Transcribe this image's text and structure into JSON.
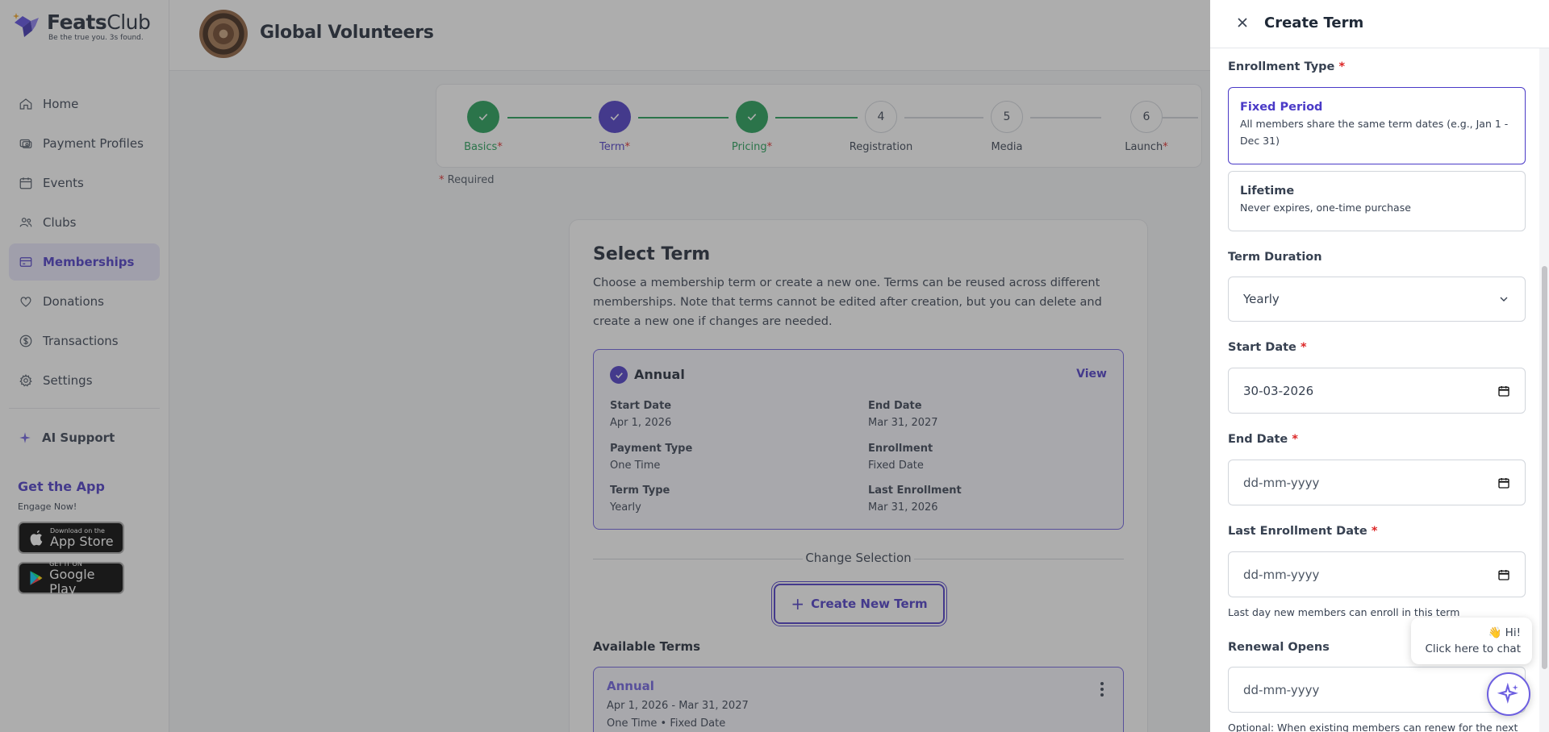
{
  "brand": {
    "name_bold": "Feats",
    "name_light": "Club",
    "tagline": "Be the true you. 3s found."
  },
  "sidebar": {
    "items": [
      {
        "label": "Home",
        "icon": "home-icon"
      },
      {
        "label": "Payment Profiles",
        "icon": "payment-icon"
      },
      {
        "label": "Events",
        "icon": "calendar-icon"
      },
      {
        "label": "Clubs",
        "icon": "users-icon"
      },
      {
        "label": "Memberships",
        "icon": "card-icon",
        "active": true
      },
      {
        "label": "Donations",
        "icon": "heart-icon"
      },
      {
        "label": "Transactions",
        "icon": "dollar-icon"
      },
      {
        "label": "Settings",
        "icon": "gear-icon"
      }
    ],
    "ai_support": "AI Support",
    "get_app": "Get the App",
    "engage": "Engage Now!",
    "app_store": {
      "small": "Download on the",
      "big": "App Store"
    },
    "google_play": {
      "small": "GET IT ON",
      "big": "Google Play"
    }
  },
  "org": {
    "name": "Global Volunteers"
  },
  "stepper": {
    "steps": [
      {
        "num": "",
        "label": "Basics",
        "required": "*",
        "state": "done"
      },
      {
        "num": "",
        "label": "Term",
        "required": "*",
        "state": "current"
      },
      {
        "num": "",
        "label": "Pricing",
        "required": "*",
        "state": "done"
      },
      {
        "num": "4",
        "label": "Registration",
        "required": "",
        "state": "todo"
      },
      {
        "num": "5",
        "label": "Media",
        "required": "",
        "state": "todo"
      },
      {
        "num": "6",
        "label": "Launch",
        "required": "*",
        "state": "todo"
      }
    ],
    "required_note_star": "*",
    "required_note": " Required"
  },
  "select_term": {
    "title": "Select Term",
    "description": "Choose a membership term or create a new one. Terms can be reused across different memberships. Note that terms cannot be edited after creation, but you can delete and create a new one if changes are needed.",
    "selected": {
      "name": "Annual",
      "view": "View",
      "start_date_label": "Start Date",
      "start_date": "Apr 1, 2026",
      "end_date_label": "End Date",
      "end_date": "Mar 31, 2027",
      "payment_type_label": "Payment Type",
      "payment_type": "One Time",
      "enrollment_label": "Enrollment",
      "enrollment": "Fixed Date",
      "term_type_label": "Term Type",
      "term_type": "Yearly",
      "last_enrollment_label": "Last Enrollment",
      "last_enrollment": "Mar 31, 2026"
    },
    "change_selection": "Change Selection",
    "create_new": "Create New Term",
    "available_title": "Available Terms",
    "available": [
      {
        "name": "Annual",
        "dates": "Apr 1, 2026 - Mar 31, 2027",
        "meta": "One Time • Fixed Date"
      }
    ]
  },
  "panel": {
    "title": "Create Term",
    "enrollment_type_label": "Enrollment Type",
    "required_star": "*",
    "options": [
      {
        "title": "Fixed Period",
        "desc": "All members share the same term dates (e.g., Jan 1 - Dec 31)",
        "selected": true
      },
      {
        "title": "Lifetime",
        "desc": "Never expires, one-time purchase",
        "selected": false
      }
    ],
    "term_duration_label": "Term Duration",
    "term_duration_value": "Yearly",
    "start_date_label": "Start Date",
    "start_date_value": "30-03-2026",
    "end_date_label": "End Date",
    "end_date_placeholder": "dd-mm-yyyy",
    "last_enrollment_label": "Last Enrollment Date",
    "last_enrollment_placeholder": "dd-mm-yyyy",
    "last_enrollment_hint": "Last day new members can enroll in this term",
    "renewal_label": "Renewal Opens",
    "renewal_placeholder": "dd-mm-yyyy",
    "renewal_hint": "Optional: When existing members can renew for the next"
  },
  "chat": {
    "line1": "👋 Hi!",
    "line2": "Click here to chat"
  },
  "colors": {
    "accent": "#4a3ac7",
    "success": "#1f9d55",
    "required": "#dc2626"
  }
}
